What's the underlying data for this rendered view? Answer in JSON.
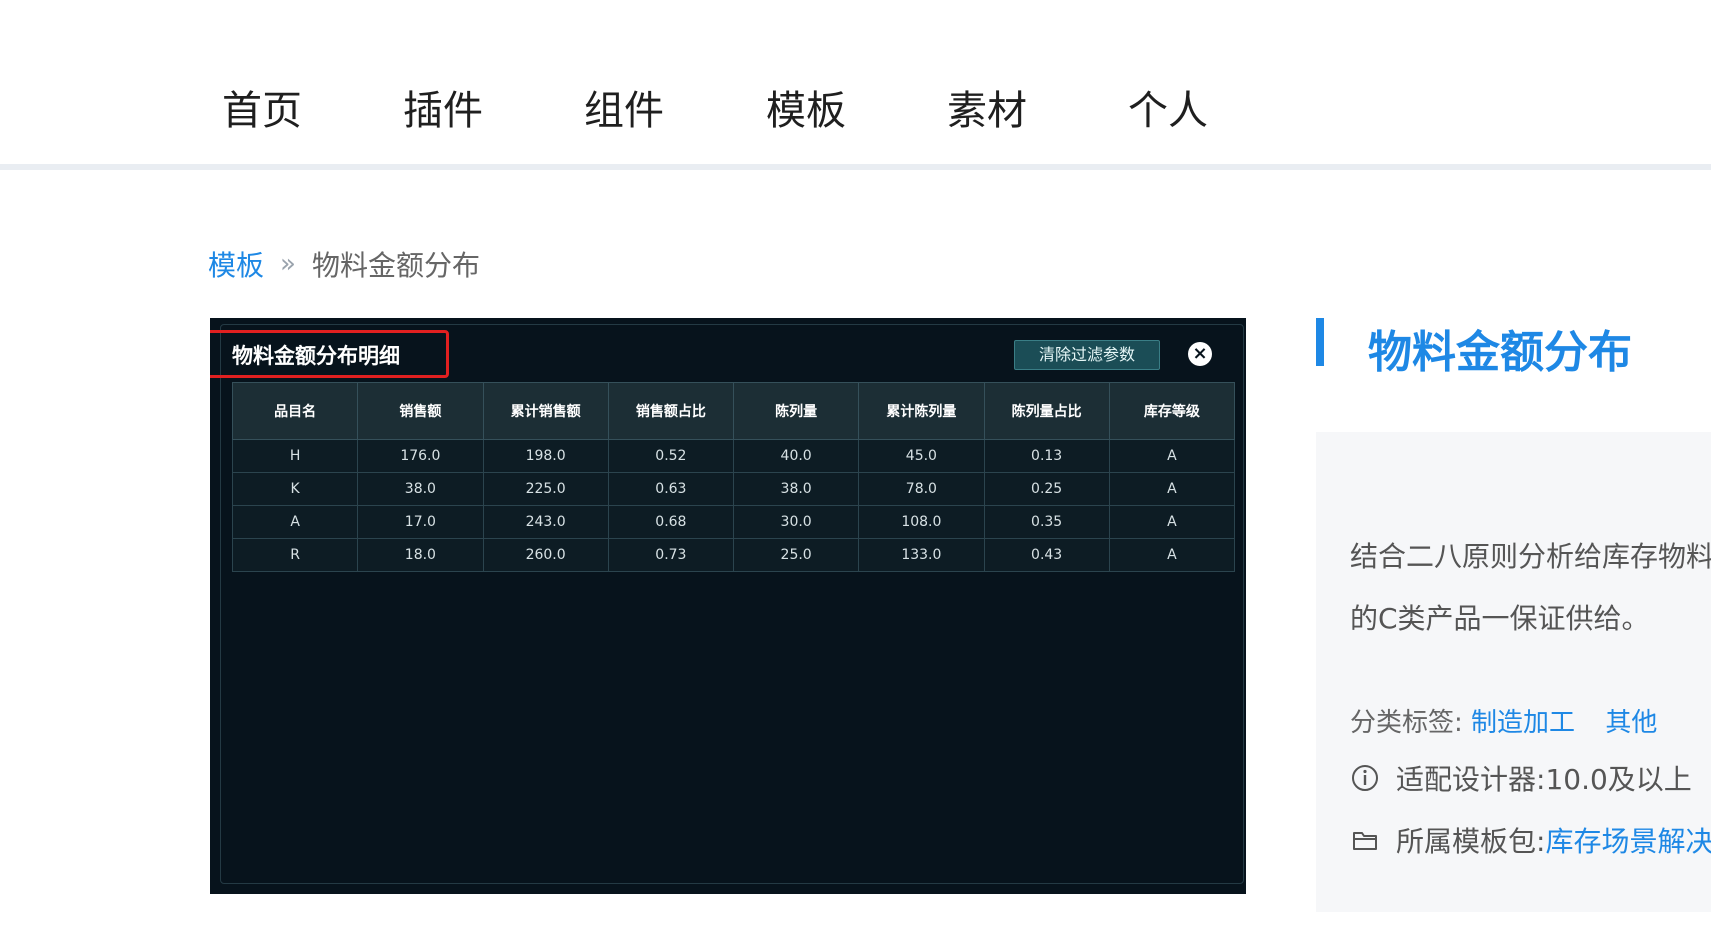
{
  "nav": {
    "items": [
      "首页",
      "插件",
      "组件",
      "模板",
      "素材",
      "个人"
    ]
  },
  "breadcrumb": {
    "parent": "模板",
    "separator": "»",
    "current": "物料金额分布"
  },
  "preview": {
    "panel_title": "物料金额分布明细",
    "clear_button": "清除过滤参数",
    "close_symbol": "×",
    "table": {
      "headers": [
        "品目名",
        "销售额",
        "累计销售额",
        "销售额占比",
        "陈列量",
        "累计陈列量",
        "陈列量占比",
        "库存等级"
      ],
      "rows": [
        [
          "H",
          "176.0",
          "198.0",
          "0.52",
          "40.0",
          "45.0",
          "0.13",
          "A"
        ],
        [
          "K",
          "38.0",
          "225.0",
          "0.63",
          "38.0",
          "78.0",
          "0.25",
          "A"
        ],
        [
          "A",
          "17.0",
          "243.0",
          "0.68",
          "30.0",
          "108.0",
          "0.35",
          "A"
        ],
        [
          "R",
          "18.0",
          "260.0",
          "0.73",
          "25.0",
          "133.0",
          "0.43",
          "A"
        ]
      ]
    }
  },
  "side": {
    "title": "物料金额分布",
    "description": "结合二八原则分析给库存物料值的C类产品一保证供给。",
    "tags_label": "分类标签:",
    "tags": [
      "制造加工",
      "其他"
    ],
    "designer_label": "适配设计器:",
    "designer_value": "10.0及以上",
    "package_label": "所属模板包:",
    "package_value": "库存场景解决"
  },
  "colors": {
    "accent": "#1e88e5",
    "highlight": "#e02020",
    "dashboard_bg": "#07131c"
  }
}
